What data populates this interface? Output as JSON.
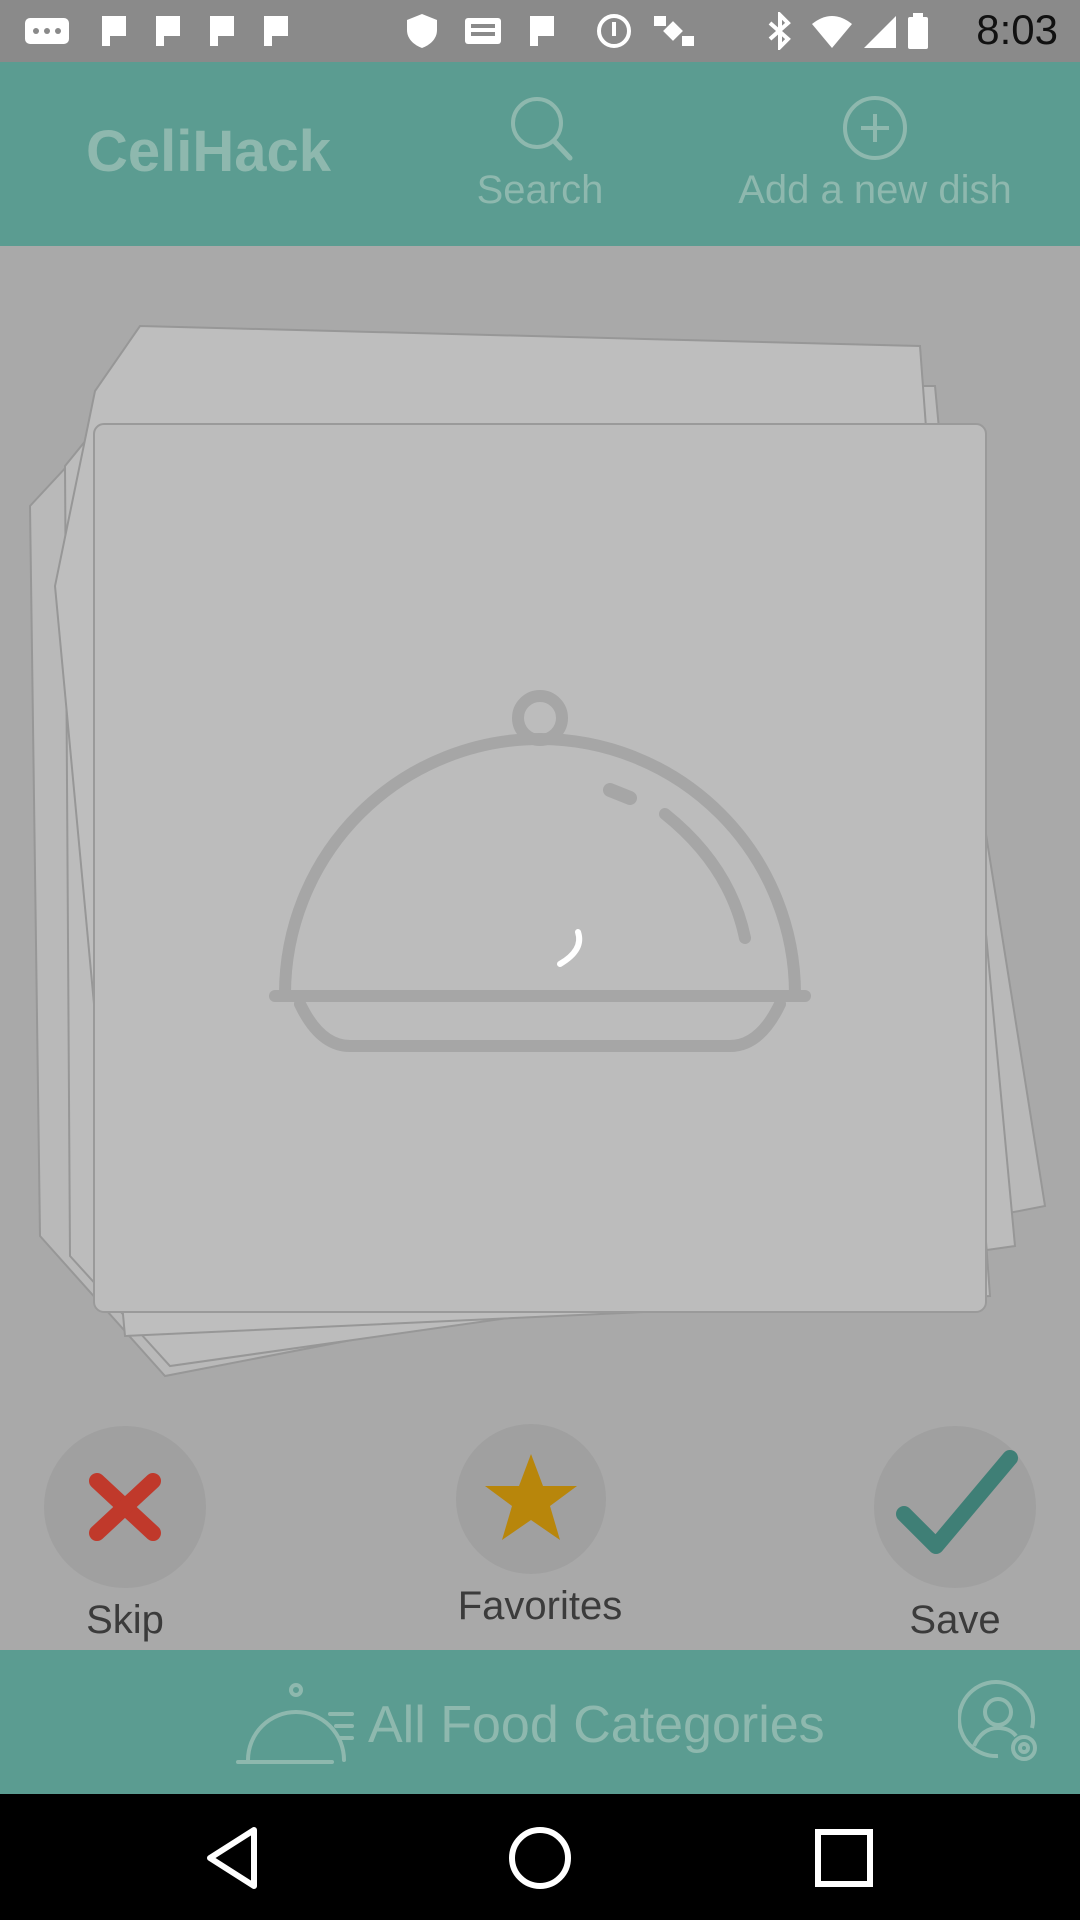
{
  "status_bar": {
    "time": "8:03",
    "icons": [
      "messaging-icon",
      "flag-icon",
      "flag-icon",
      "flag-icon",
      "shield-icon",
      "inbox-icon",
      "flag-icon",
      "info-icon",
      "satellite-icon",
      "bluetooth-icon",
      "wifi-icon",
      "signal-icon",
      "battery-icon"
    ]
  },
  "header": {
    "title": "CeliHack",
    "search_label": "Search",
    "add_label": "Add a new dish"
  },
  "main": {
    "placeholder_icon": "food-cloche-icon",
    "loading": true
  },
  "actions": {
    "skip_label": "Skip",
    "favorites_label": "Favorites",
    "save_label": "Save"
  },
  "footer": {
    "categories_label": "All Food Categories"
  },
  "colors": {
    "header_bg": "#5b9c91",
    "header_text": "#8eb8ae",
    "overlay_bg": "#a9a9a9",
    "skip_red": "#c0392b",
    "star_gold": "#b8860b",
    "save_teal": "#3f7f76"
  }
}
